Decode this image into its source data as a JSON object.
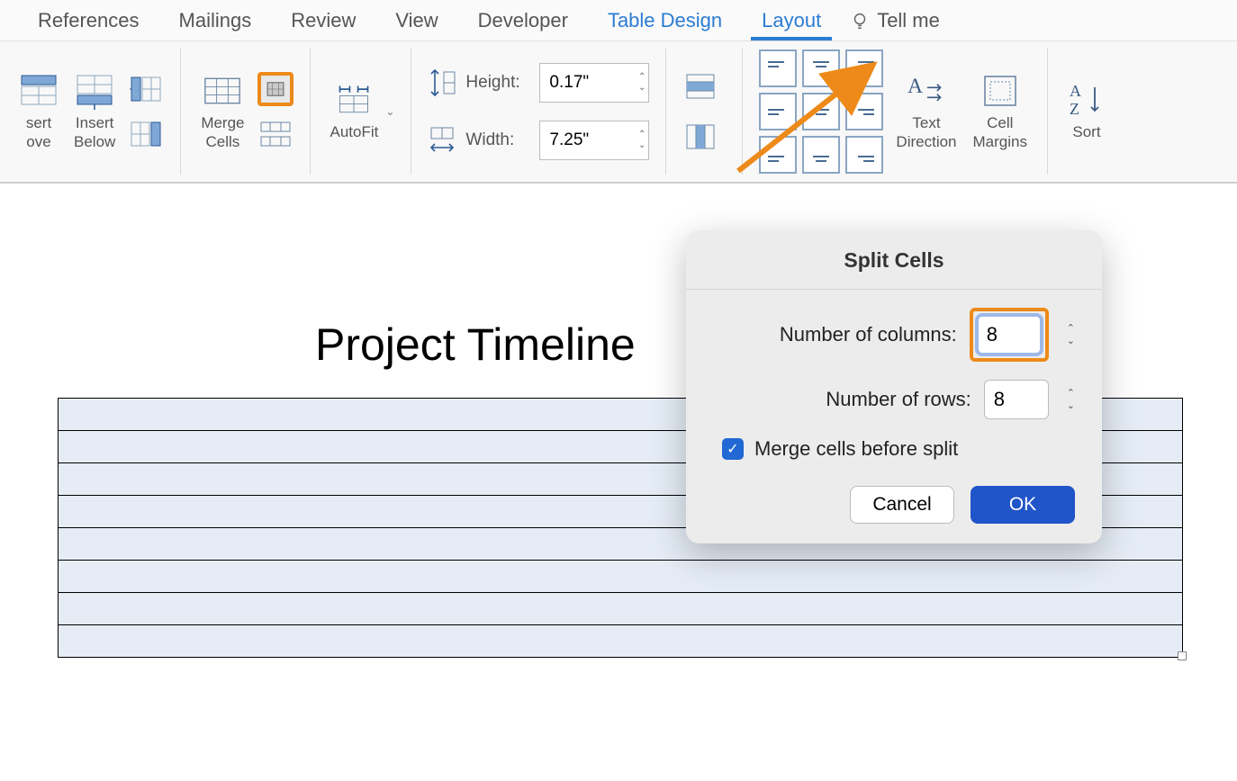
{
  "tabs": {
    "references": "References",
    "mailings": "Mailings",
    "review": "Review",
    "view": "View",
    "developer": "Developer",
    "table_design": "Table Design",
    "layout": "Layout",
    "tell_me": "Tell me"
  },
  "toolbar": {
    "insert_above": "sert\nove",
    "insert_below": "Insert\nBelow",
    "merge_cells": "Merge\nCells",
    "autofit": "AutoFit",
    "height_label": "Height:",
    "height_value": "0.17\"",
    "width_label": "Width:",
    "width_value": "7.25\"",
    "text_direction": "Text\nDirection",
    "cell_margins": "Cell\nMargins",
    "sort": "Sort"
  },
  "document": {
    "title": "Project Timeline"
  },
  "dialog": {
    "title": "Split Cells",
    "cols_label": "Number of columns:",
    "cols_value": "8",
    "rows_label": "Number of rows:",
    "rows_value": "8",
    "merge_label": "Merge cells before split",
    "cancel": "Cancel",
    "ok": "OK"
  }
}
